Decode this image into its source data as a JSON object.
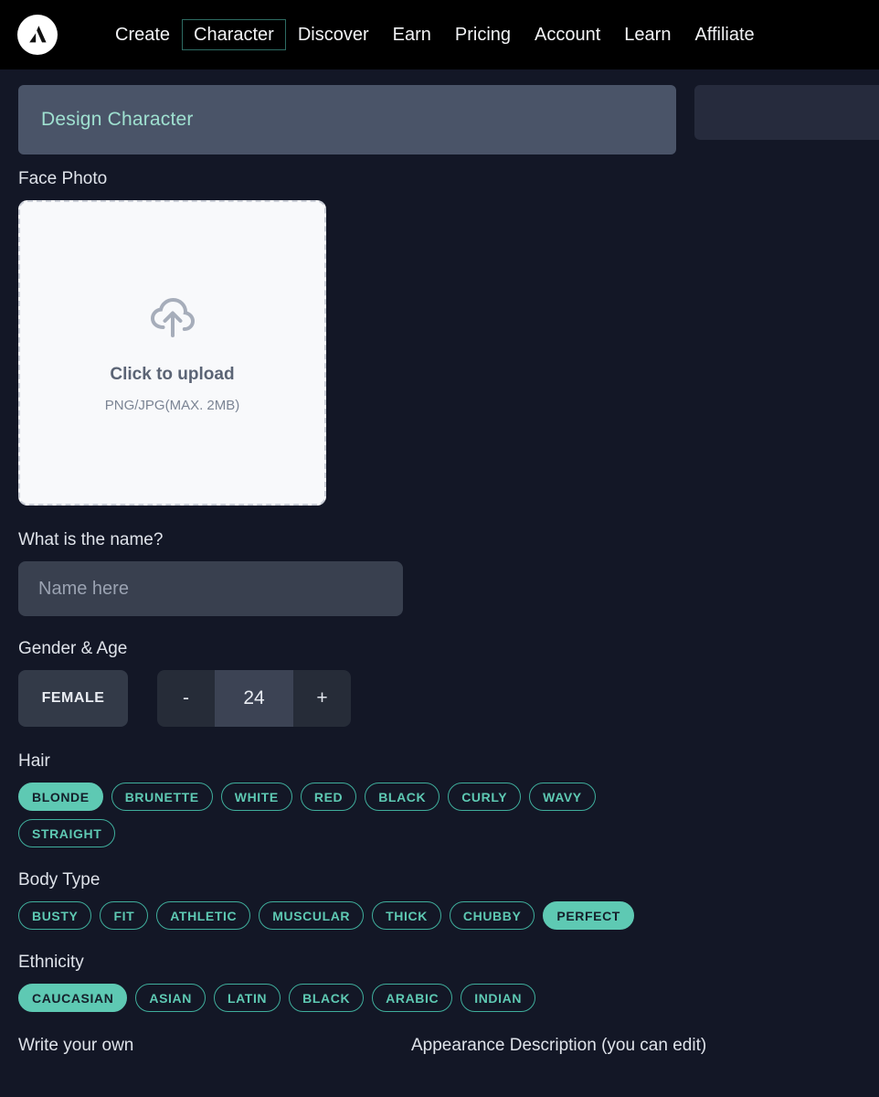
{
  "nav": {
    "logo_icon": "triangle-a-logo-icon",
    "links": [
      {
        "label": "Create",
        "focused": false
      },
      {
        "label": "Character",
        "focused": true
      },
      {
        "label": "Discover",
        "focused": false
      },
      {
        "label": "Earn",
        "focused": false
      },
      {
        "label": "Pricing",
        "focused": false
      },
      {
        "label": "Account",
        "focused": false
      },
      {
        "label": "Learn",
        "focused": false
      },
      {
        "label": "Affiliate",
        "focused": false
      }
    ]
  },
  "tabs": {
    "active_label": "Design Character",
    "inactive_label": ""
  },
  "form": {
    "face_photo": {
      "label": "Face Photo",
      "upload_icon": "cloud-upload-icon",
      "title": "Click to upload",
      "subtitle": "PNG/JPG(MAX. 2MB)"
    },
    "name": {
      "label": "What is the name?",
      "placeholder": "Name here",
      "value": ""
    },
    "gender_age": {
      "label": "Gender & Age",
      "gender_value": "FEMALE",
      "decrement_label": "-",
      "age_value": "24",
      "increment_label": "+"
    },
    "hair": {
      "label": "Hair",
      "options": [
        {
          "label": "BLONDE",
          "selected": true
        },
        {
          "label": "BRUNETTE",
          "selected": false
        },
        {
          "label": "WHITE",
          "selected": false
        },
        {
          "label": "RED",
          "selected": false
        },
        {
          "label": "BLACK",
          "selected": false
        },
        {
          "label": "CURLY",
          "selected": false
        },
        {
          "label": "WAVY",
          "selected": false
        },
        {
          "label": "STRAIGHT",
          "selected": false
        }
      ]
    },
    "body_type": {
      "label": "Body Type",
      "options": [
        {
          "label": "BUSTY",
          "selected": false
        },
        {
          "label": "FIT",
          "selected": false
        },
        {
          "label": "ATHLETIC",
          "selected": false
        },
        {
          "label": "MUSCULAR",
          "selected": false
        },
        {
          "label": "THICK",
          "selected": false
        },
        {
          "label": "CHUBBY",
          "selected": false
        },
        {
          "label": "PERFECT",
          "selected": true
        }
      ]
    },
    "ethnicity": {
      "label": "Ethnicity",
      "options": [
        {
          "label": "CAUCASIAN",
          "selected": true
        },
        {
          "label": "ASIAN",
          "selected": false
        },
        {
          "label": "LATIN",
          "selected": false
        },
        {
          "label": "BLACK",
          "selected": false
        },
        {
          "label": "ARABIC",
          "selected": false
        },
        {
          "label": "INDIAN",
          "selected": false
        }
      ]
    },
    "bottom": {
      "write_your_own_label": "Write your own",
      "appearance_label": "Appearance Description (you can edit)"
    }
  },
  "colors": {
    "nav_background": "#000000",
    "page_background": "#131726",
    "active_tab": "#4a5468",
    "inactive_tab": "#262b3d",
    "accent_teal": "#5ec9b3",
    "title_teal": "#9fe0d0",
    "input_background": "#39404f",
    "upload_background": "#f8f9fb"
  }
}
